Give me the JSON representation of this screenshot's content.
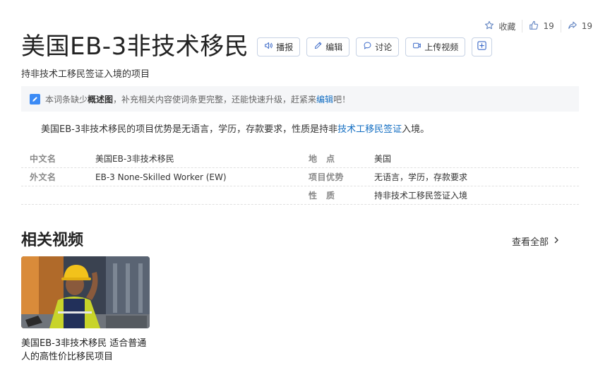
{
  "top_actions": {
    "favorite_label": "收藏",
    "like_count": "19",
    "share_count": "19"
  },
  "title": "美国EB-3非技术移民",
  "title_buttons": {
    "broadcast": "播报",
    "edit": "编辑",
    "discuss": "讨论",
    "upload_video": "上传视频"
  },
  "subtitle": "持非技术工移民签证入境的项目",
  "notice": {
    "prefix": "本词条缺少",
    "missing": "概述图",
    "middle": "，补充相关内容使词条更完整，还能快速升级，赶紧来",
    "link": "编辑",
    "suffix": "吧！"
  },
  "summary": {
    "before": "美国EB-3非技术移民的项目优势是无语言，学历，存款要求，性质是持非",
    "link": "技术工移民签证",
    "after": "入境。"
  },
  "infobox": [
    [
      {
        "label": "中文名",
        "value": "美国EB-3非技术移民"
      },
      {
        "label": "地　点",
        "value": "美国"
      }
    ],
    [
      {
        "label": "外文名",
        "value": "EB-3 None-Skilled Worker (EW)"
      },
      {
        "label": "项目优势",
        "value": "无语言，学历，存款要求"
      }
    ],
    [
      {
        "label": "",
        "value": ""
      },
      {
        "label": "性　质",
        "value": "持非技术工移民签证入境"
      }
    ]
  ],
  "related_videos": {
    "title": "相关视频",
    "view_all": "查看全部",
    "items": [
      {
        "caption": "美国EB-3非技术移民 适合普通人的高性价比移民项目"
      }
    ]
  },
  "colors": {
    "link": "#136ec2",
    "notice_bg": "#f5f6f8",
    "edit_icon": "#3c8bf5",
    "button_border": "#c7d2e4"
  }
}
